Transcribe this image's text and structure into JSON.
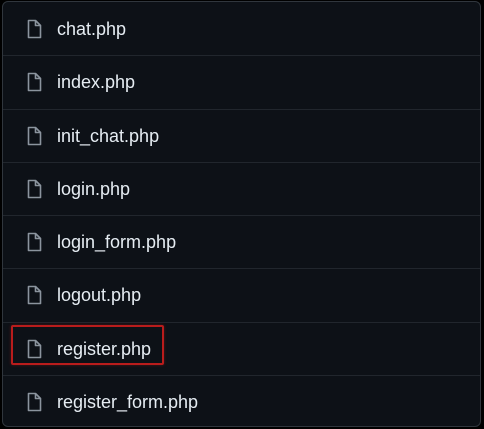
{
  "file_list": {
    "icon": "file-icon",
    "files": [
      {
        "name": "chat.php"
      },
      {
        "name": "index.php"
      },
      {
        "name": "init_chat.php"
      },
      {
        "name": "login.php"
      },
      {
        "name": "login_form.php"
      },
      {
        "name": "logout.php"
      },
      {
        "name": "register.php",
        "highlighted": true
      },
      {
        "name": "register_form.php"
      }
    ]
  },
  "colors": {
    "background": "#0d1117",
    "text": "#e6edf3",
    "icon": "#8b949e",
    "row_divider": "#21262d",
    "highlight_border": "#b91c1c"
  }
}
